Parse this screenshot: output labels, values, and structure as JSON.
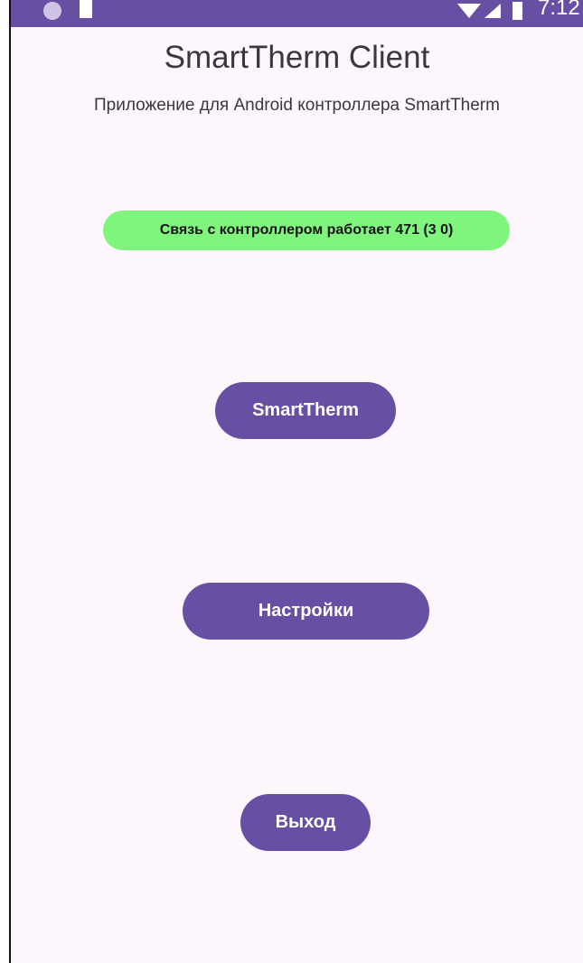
{
  "status_bar": {
    "time": "7:12",
    "background_color": "#6750a4"
  },
  "app": {
    "title": "SmartTherm Client",
    "subtitle": "Приложение для Android контроллера SmartTherm"
  },
  "connection_status": {
    "text": "Связь с контроллером работает 471 (3 0)",
    "color": "#80f57e"
  },
  "buttons": {
    "smarttherm_label": "SmartTherm",
    "settings_label": "Настройки",
    "exit_label": "Выход",
    "color": "#6750a4"
  }
}
